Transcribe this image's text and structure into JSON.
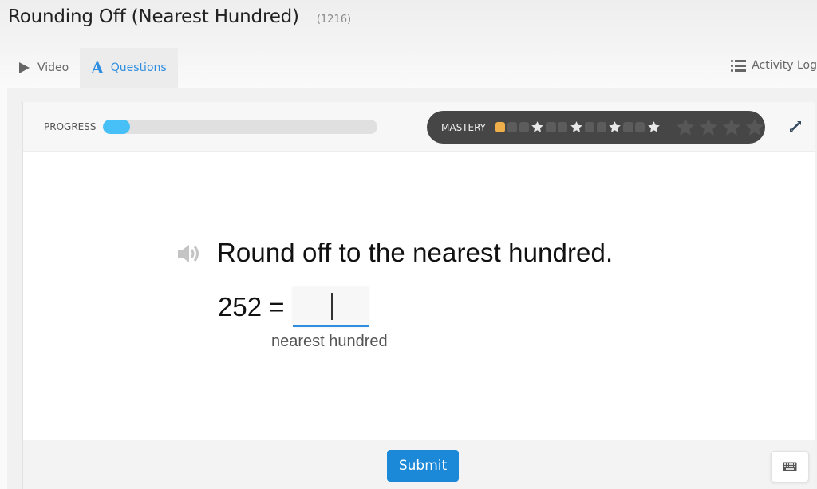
{
  "header": {
    "title": "Rounding Off (Nearest Hundred)",
    "code": "(1216)"
  },
  "tabs": [
    {
      "label": "Video",
      "icon": "play-icon",
      "active": false
    },
    {
      "label": "Questions",
      "icon": "letter-a-icon",
      "active": true
    }
  ],
  "activity_log": {
    "label": "Activity Log",
    "icon": "list-icon"
  },
  "progress": {
    "label": "PROGRESS",
    "value_percent": 10
  },
  "mastery": {
    "label": "MASTERY",
    "sequence": [
      "done",
      "empty",
      "empty",
      "star",
      "empty",
      "empty",
      "star",
      "empty",
      "empty",
      "star",
      "empty",
      "empty",
      "star"
    ],
    "big_stars": 4,
    "big_stars_earned": 0
  },
  "question": {
    "prompt": "Round off to the nearest hundred.",
    "equation_left": "252 =",
    "answer_value": "",
    "hint": "nearest hundred"
  },
  "footer": {
    "submit_label": "Submit",
    "keyboard_icon": "keyboard-icon"
  },
  "colors": {
    "accent": "#2d8ee0",
    "submit": "#1b88d8",
    "progress_fill": "#47c0f8",
    "mastery_done": "#eeaf4b",
    "mastery_bg": "#464646"
  }
}
